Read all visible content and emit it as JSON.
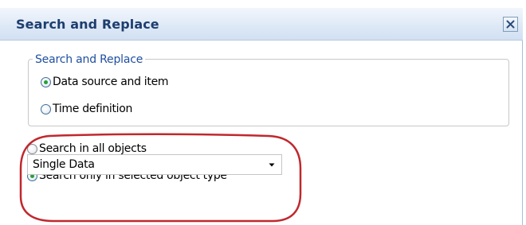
{
  "window": {
    "title": "Search and Replace",
    "close_icon": "close-icon"
  },
  "group": {
    "legend": "Search and Replace",
    "options": [
      {
        "label": "Data source and item",
        "selected": true
      },
      {
        "label": "Time definition",
        "selected": false
      }
    ]
  },
  "scope": {
    "options": [
      {
        "label": "Search in all objects",
        "selected": false
      },
      {
        "label": "Search only in selected object type",
        "selected": true
      }
    ]
  },
  "object_type": {
    "value": "Single Data",
    "arrow_icon": "dropdown-arrow-icon"
  },
  "colors": {
    "title_text": "#1d3e6e",
    "legend_text": "#1f4fa0",
    "radio_dot": "#22a13a",
    "highlight": "#c0282d"
  }
}
